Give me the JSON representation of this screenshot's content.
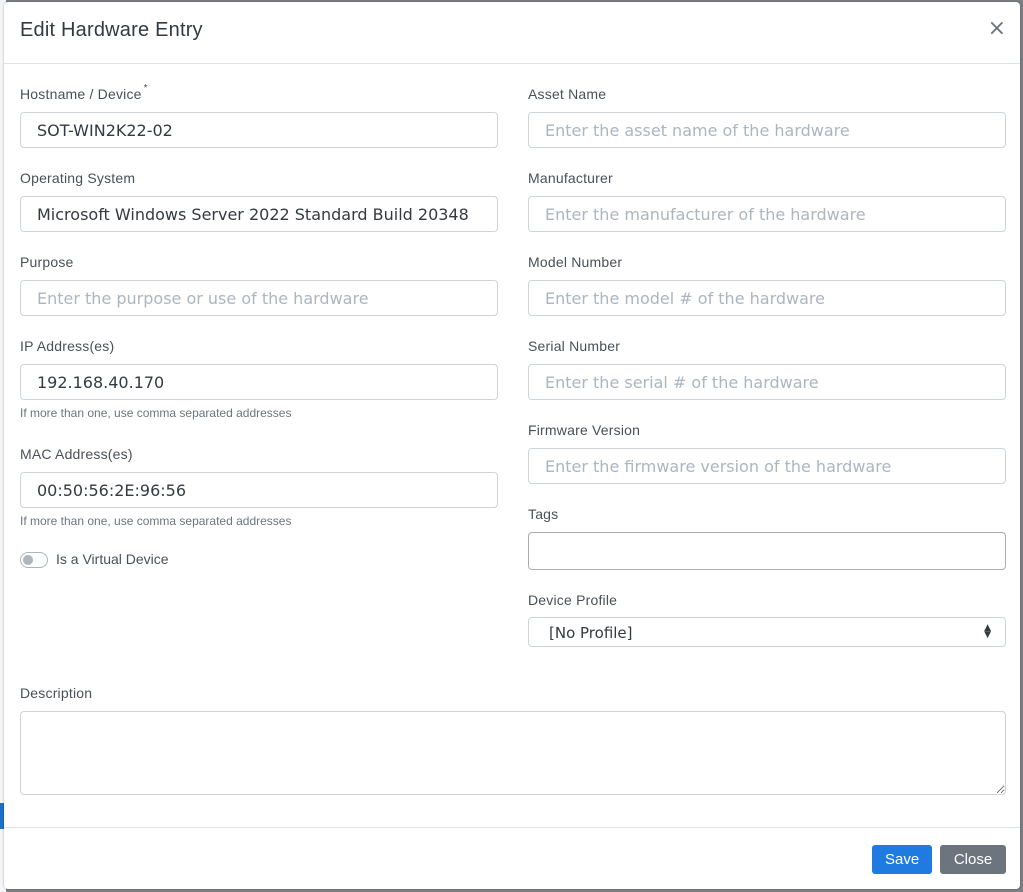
{
  "modal": {
    "title": "Edit Hardware Entry",
    "close_glyph": "×"
  },
  "left": {
    "hostname": {
      "label": "Hostname / Device",
      "required_mark": "*",
      "value": "SOT-WIN2K22-02",
      "placeholder": ""
    },
    "os": {
      "label": "Operating System",
      "value": "Microsoft Windows Server 2022 Standard Build 20348",
      "placeholder": ""
    },
    "purpose": {
      "label": "Purpose",
      "value": "",
      "placeholder": "Enter the purpose or use of the hardware"
    },
    "ip": {
      "label": "IP Address(es)",
      "value": "192.168.40.170",
      "placeholder": "",
      "help": "If more than one, use comma separated addresses"
    },
    "mac": {
      "label": "MAC Address(es)",
      "value": "00:50:56:2E:96:56",
      "placeholder": "",
      "help": "If more than one, use comma separated addresses"
    },
    "virtual": {
      "label": "Is a Virtual Device",
      "checked": false
    }
  },
  "right": {
    "asset_name": {
      "label": "Asset Name",
      "placeholder": "Enter the asset name of the hardware"
    },
    "manufacturer": {
      "label": "Manufacturer",
      "placeholder": "Enter the manufacturer of the hardware"
    },
    "model": {
      "label": "Model Number",
      "placeholder": "Enter the model # of the hardware"
    },
    "serial": {
      "label": "Serial Number",
      "placeholder": "Enter the serial # of the hardware"
    },
    "firmware": {
      "label": "Firmware Version",
      "placeholder": "Enter the firmware version of the hardware"
    },
    "tags": {
      "label": "Tags"
    },
    "profile": {
      "label": "Device Profile",
      "selected": "[No Profile]",
      "chevron": "▲\n▼"
    }
  },
  "description": {
    "label": "Description",
    "value": ""
  },
  "footer": {
    "save_label": "Save",
    "close_label": "Close"
  },
  "colors": {
    "primary": "#1f7be0",
    "secondary": "#6c757d"
  }
}
